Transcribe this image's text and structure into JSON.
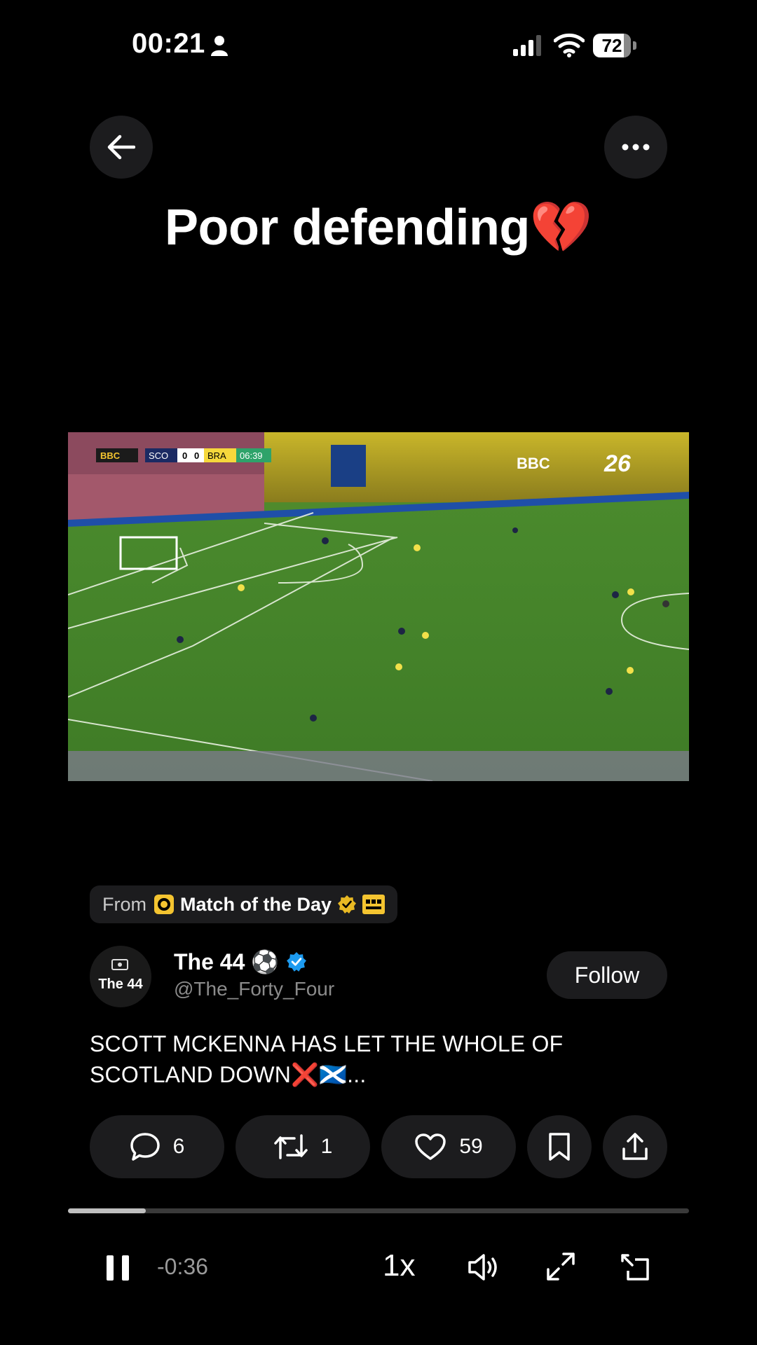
{
  "status_bar": {
    "time": "00:21",
    "battery": "72"
  },
  "nav": {
    "back_icon": "arrow-left-icon",
    "more_icon": "more-horizontal-icon"
  },
  "title": "Poor defending💔",
  "video": {
    "scoreboard": {
      "broadcaster": "BBC",
      "home": "SCO",
      "home_score": "0",
      "away_score": "0",
      "away": "BRA",
      "clock": "06:39"
    },
    "watermark_text": "BBC",
    "tournament_logo": "26"
  },
  "source": {
    "prefix": "From",
    "name": "Match of the Day",
    "verified_color": "#e8b923"
  },
  "author": {
    "avatar_text": "The 44",
    "name": "The 44 ⚽️",
    "handle": "@The_Forty_Four",
    "follow_label": "Follow",
    "verified_color": "#1d9bf0"
  },
  "tweet": {
    "text": "SCOTT MCKENNA HAS LET THE WHOLE OF SCOTLAND DOWN❌🏴󠁧󠁢󠁳󠁣󠁴󠁿..."
  },
  "actions": {
    "replies": "6",
    "retweets": "1",
    "likes": "59"
  },
  "player": {
    "progress": 0.125,
    "time_remaining": "-0:36",
    "speed": "1x"
  }
}
